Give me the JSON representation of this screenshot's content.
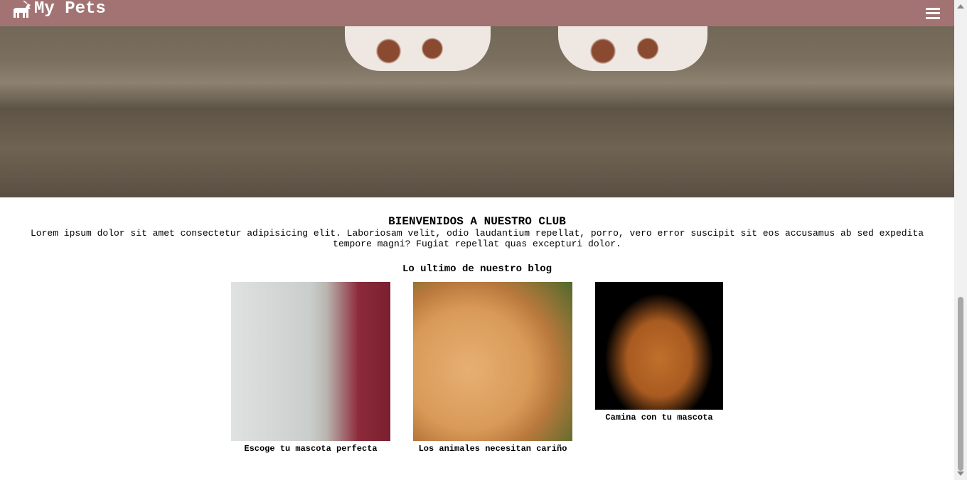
{
  "header": {
    "brand": "My Pets",
    "logo_icon": "dog-walking-icon",
    "menu_icon": "hamburger-menu-icon",
    "color": "#a37373"
  },
  "welcome": {
    "title": "BIENVENIDOS A NUESTRO CLUB",
    "text": "Lorem ipsum dolor sit amet consectetur adipisicing elit. Laboriosam velit, odio laudantium repellat, porro, vero error suscipit sit eos accusamus ab sed expedita tempore magni? Fugiat repellat quas excepturi dolor."
  },
  "blog": {
    "title": "Lo ultimo de nuestro blog",
    "posts": [
      {
        "caption": "Escoge tu mascota perfecta"
      },
      {
        "caption": "Los animales necesitan cariño"
      },
      {
        "caption": "Camina con tu mascota"
      }
    ]
  }
}
